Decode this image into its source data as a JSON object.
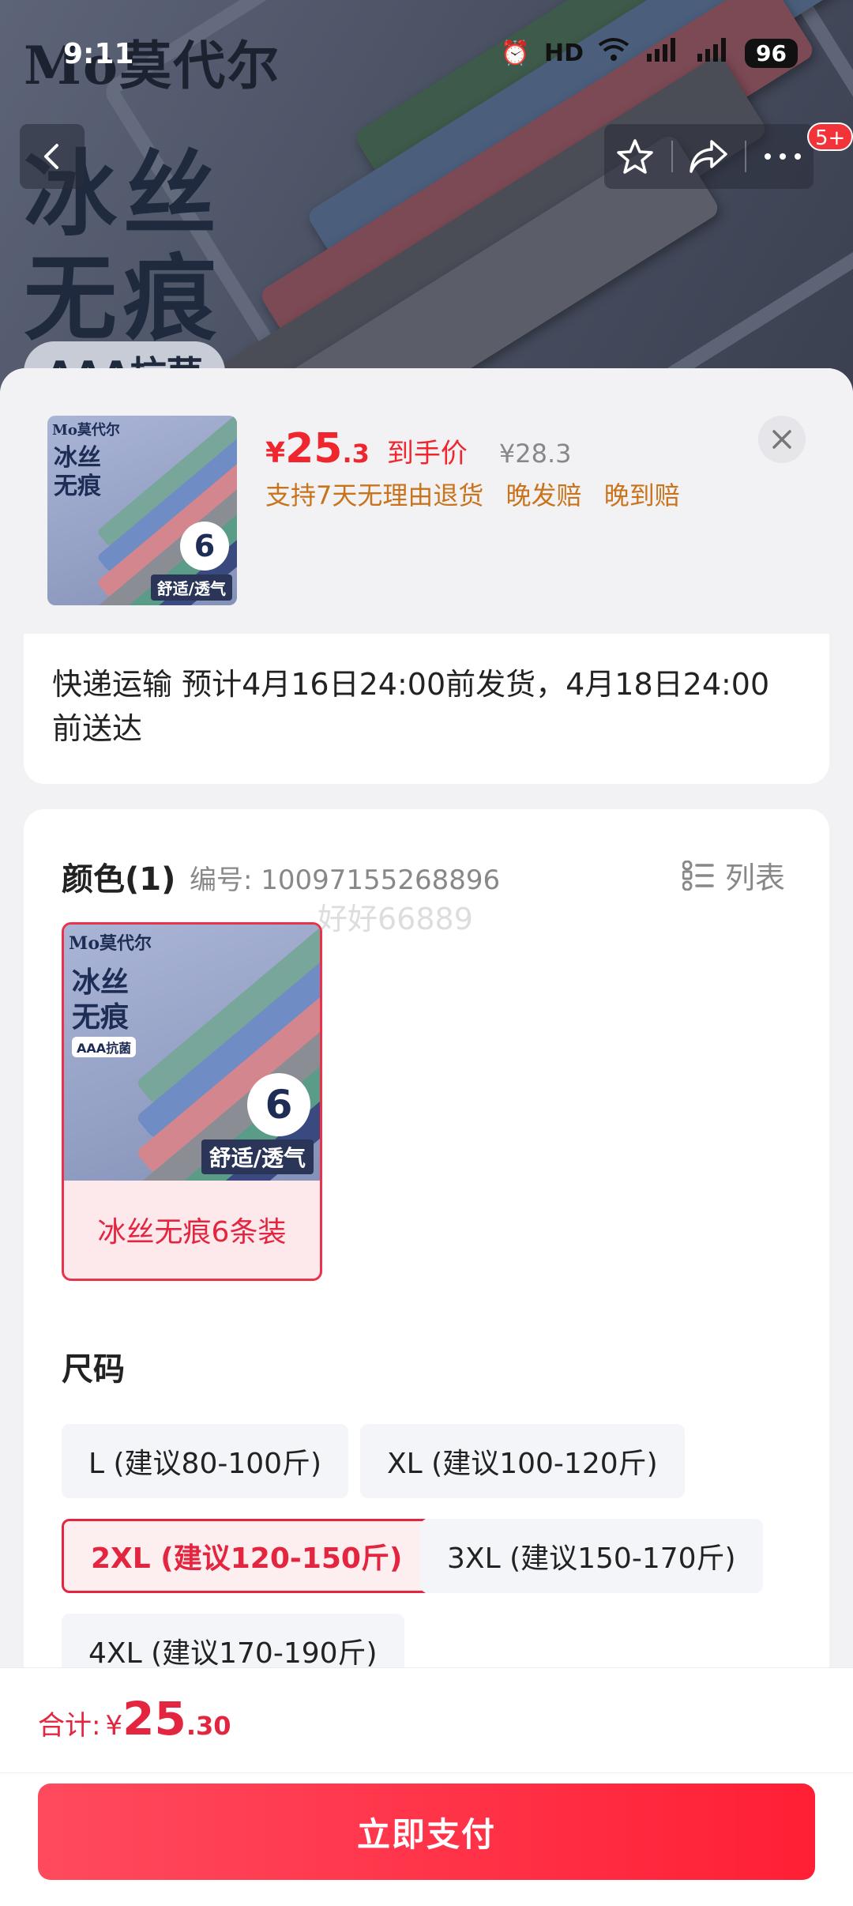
{
  "status_bar": {
    "time": "9:11",
    "battery": "96"
  },
  "banner": {
    "brand": "Mo莫代尔",
    "title_line1": "冰丝",
    "title_line2": "无痕",
    "badge": "AAA抗菌"
  },
  "nav": {
    "badge": "5+"
  },
  "product": {
    "price_currency": "¥",
    "price_int": "25",
    "price_dec": ".3",
    "price_tag": "到手价",
    "original_price": "¥28.3",
    "promises": [
      "支持7天无理由退货",
      "晚发赔",
      "晚到赔"
    ],
    "thumb_title": "冰丝\n无痕",
    "thumb_badge": "6",
    "thumb_foot": "舒适/透气"
  },
  "shipping": {
    "text": "快递运输 预计4月16日24:00前发货，4月18日24:00前送达"
  },
  "color_section": {
    "title": "颜色(1)",
    "code": "编号: 10097155268896",
    "list_label": "列表",
    "watermark": "好好66889",
    "options": [
      {
        "label": "冰丝无痕6条装",
        "selected": true
      }
    ]
  },
  "size_section": {
    "title": "尺码",
    "options": [
      {
        "label": "L (建议80-100斤)",
        "selected": false
      },
      {
        "label": "XL (建议100-120斤)",
        "selected": false
      },
      {
        "label": "2XL (建议120-150斤)",
        "selected": true
      },
      {
        "label": "3XL (建议150-170斤)",
        "selected": false
      },
      {
        "label": "4XL (建议170-190斤)",
        "selected": false
      }
    ]
  },
  "footer": {
    "total_label": "合计:",
    "total_currency": "¥",
    "total_int": "25",
    "total_dec": ".30",
    "pay_label": "立即支付"
  },
  "colors": {
    "accent": "#f0262e",
    "promise": "#c9741c",
    "selected_border": "#e3253f"
  }
}
